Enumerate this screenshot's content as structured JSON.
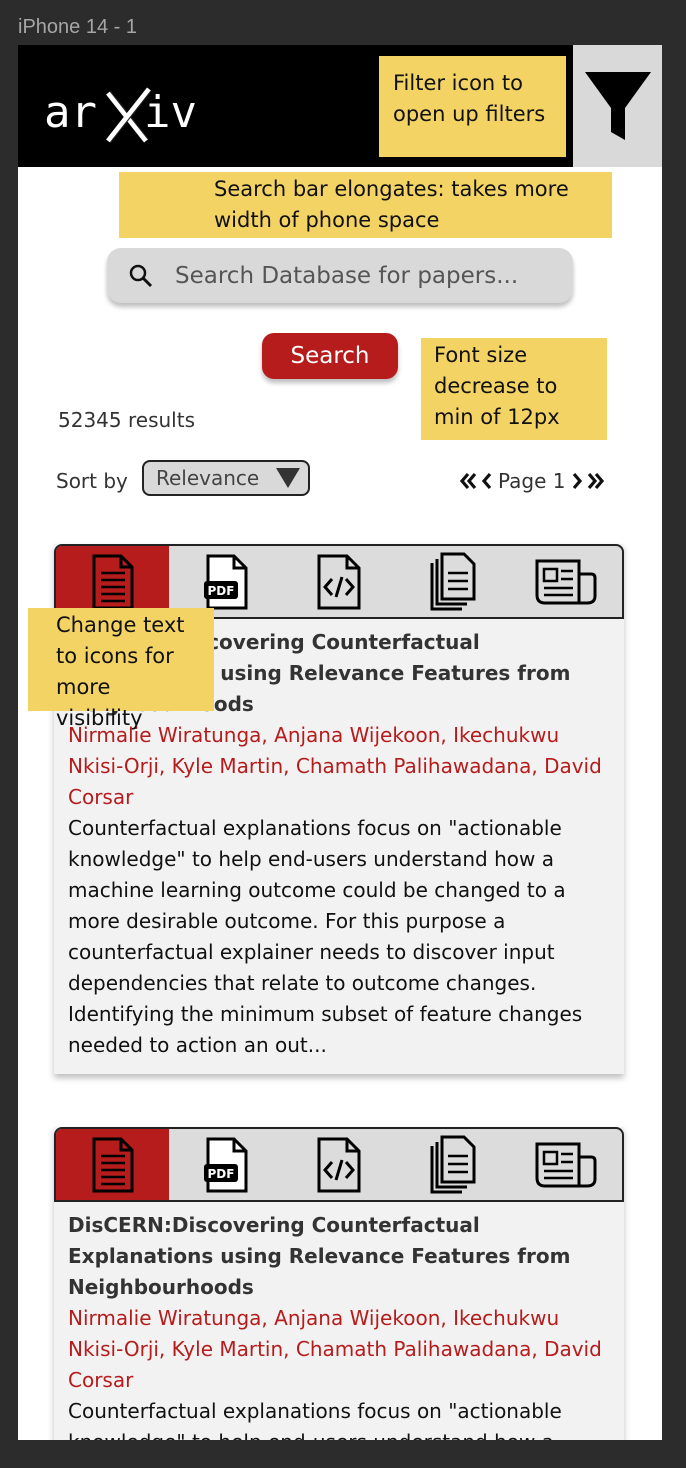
{
  "frame_label": "iPhone 14 - 1",
  "header": {
    "logo_text": "arXiv",
    "filter_icon": "filter-icon"
  },
  "notes": {
    "filter": "Filter icon to open up filters",
    "search": "Search bar elongates: takes more width of phone space",
    "font": "Font size decrease to min of 12px",
    "icons": "Change text to icons for more visibility"
  },
  "search": {
    "placeholder": "Search Database for papers...",
    "button_label": "Search"
  },
  "results_count": "52345 results",
  "sort": {
    "label": "Sort by",
    "selected": "Relevance"
  },
  "pagination": {
    "label": "Page 1"
  },
  "tab_icons": [
    "document-icon",
    "pdf-icon",
    "code-icon",
    "copy-icon",
    "news-icon"
  ],
  "colors": {
    "accent": "#b61c1c",
    "note": "#f4d365",
    "header": "#000000"
  },
  "papers": [
    {
      "title": "DisCERN:Discovering Counterfactual Explanations using Relevance Features from Neighbourhoods",
      "authors": "Nirmalie Wiratunga, Anjana Wijekoon, Ikechukwu Nkisi-Orji, Kyle Martin, Chamath Palihawadana, David Corsar",
      "abstract": "Counterfactual explanations focus on \"actionable knowledge\" to help end-users understand how a machine learning outcome could be changed to a more desirable outcome. For this purpose a counterfactual explainer needs to discover input dependencies that relate to outcome changes. Identifying the minimum subset of feature changes needed to action an out..."
    },
    {
      "title": "DisCERN:Discovering Counterfactual Explanations using Relevance Features from Neighbourhoods",
      "authors": "Nirmalie Wiratunga, Anjana Wijekoon, Ikechukwu Nkisi-Orji, Kyle Martin, Chamath Palihawadana, David Corsar",
      "abstract": "Counterfactual explanations focus on \"actionable knowledge\" to help end-users understand how a machine learning outcome could be changed to a more desirable outcome."
    }
  ]
}
